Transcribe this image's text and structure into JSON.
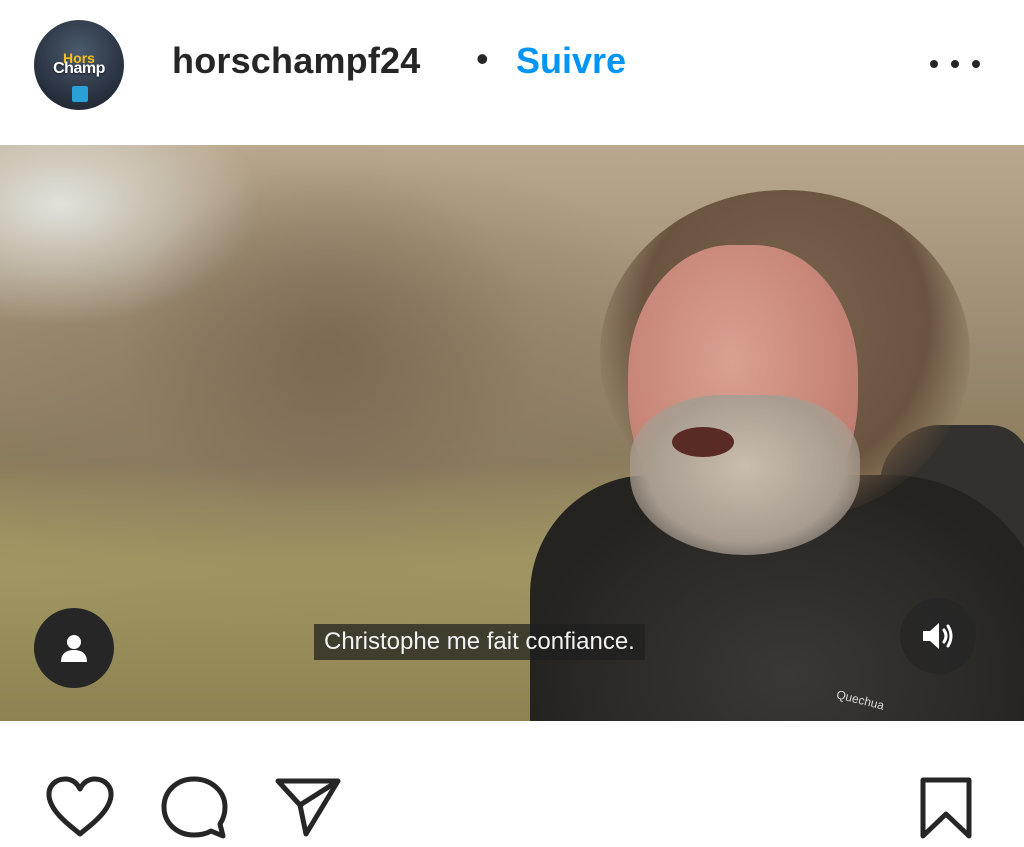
{
  "header": {
    "avatar": {
      "logo_top": "Hors",
      "logo_main": "Champ"
    },
    "username": "horschampf24",
    "separator": "•",
    "follow_label": "Suivre",
    "more_icon": "more-horizontal-icon"
  },
  "media": {
    "subtitle": "Christophe me fait confiance.",
    "brand_text": "Quechua",
    "user_tag_icon": "user-icon",
    "mute_icon": "volume-icon"
  },
  "actions": {
    "like_icon": "heart-icon",
    "comment_icon": "comment-icon",
    "share_icon": "send-icon",
    "save_icon": "bookmark-icon"
  },
  "colors": {
    "follow": "#0095f6",
    "text": "#262626",
    "background": "#ffffff"
  }
}
